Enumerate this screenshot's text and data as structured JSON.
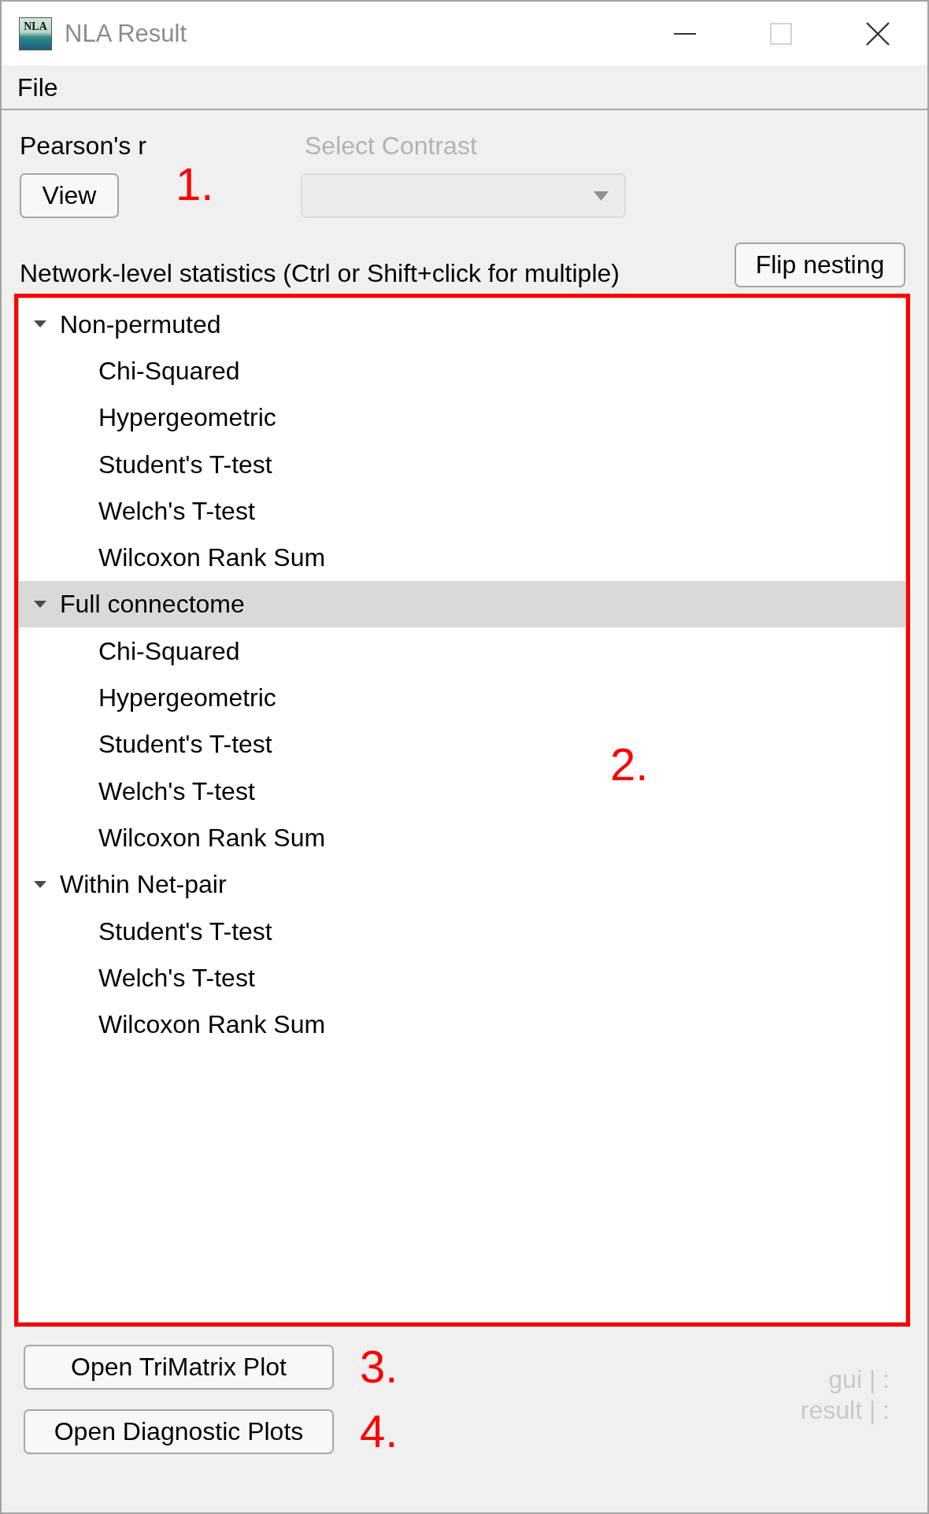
{
  "window": {
    "title": "NLA Result",
    "icon_text": "NLA",
    "controls": [
      {
        "kind": "minimize",
        "disabled": false
      },
      {
        "kind": "maximize",
        "disabled": true
      },
      {
        "kind": "close",
        "disabled": false
      }
    ]
  },
  "menu": [
    {
      "label": "File"
    }
  ],
  "test_panel": {
    "label": "Pearson's r",
    "button": "View",
    "annotation": "1."
  },
  "contrast": {
    "label": "Select Contrast",
    "disabled": true
  },
  "network_stats": {
    "label": "Network-level statistics (Ctrl or Shift+click for multiple)",
    "flip_button": "Flip nesting",
    "highlighted": true,
    "annotation": "2.",
    "nodes": [
      {
        "label": "Non-permuted",
        "expanded": true,
        "selected": false,
        "children": [
          {
            "label": "Chi-Squared",
            "selected": false
          },
          {
            "label": "Hypergeometric",
            "selected": false
          },
          {
            "label": "Student's T-test",
            "selected": false
          },
          {
            "label": "Welch's T-test",
            "selected": false
          },
          {
            "label": "Wilcoxon Rank Sum",
            "selected": false
          }
        ]
      },
      {
        "label": "Full connectome",
        "expanded": true,
        "selected": true,
        "children": [
          {
            "label": "Chi-Squared",
            "selected": false
          },
          {
            "label": "Hypergeometric",
            "selected": false
          },
          {
            "label": "Student's T-test",
            "selected": false
          },
          {
            "label": "Welch's T-test",
            "selected": false
          },
          {
            "label": "Wilcoxon Rank Sum",
            "selected": false
          }
        ]
      },
      {
        "label": "Within Net-pair",
        "expanded": true,
        "selected": false,
        "children": [
          {
            "label": "Student's T-test",
            "selected": false
          },
          {
            "label": "Welch's T-test",
            "selected": false
          },
          {
            "label": "Wilcoxon Rank Sum",
            "selected": false
          }
        ]
      }
    ]
  },
  "actions": [
    {
      "label": "Open TriMatrix Plot",
      "annotation": "3."
    },
    {
      "label": "Open Diagnostic Plots",
      "annotation": "4."
    }
  ],
  "status": [
    "gui | :",
    "result | :"
  ]
}
